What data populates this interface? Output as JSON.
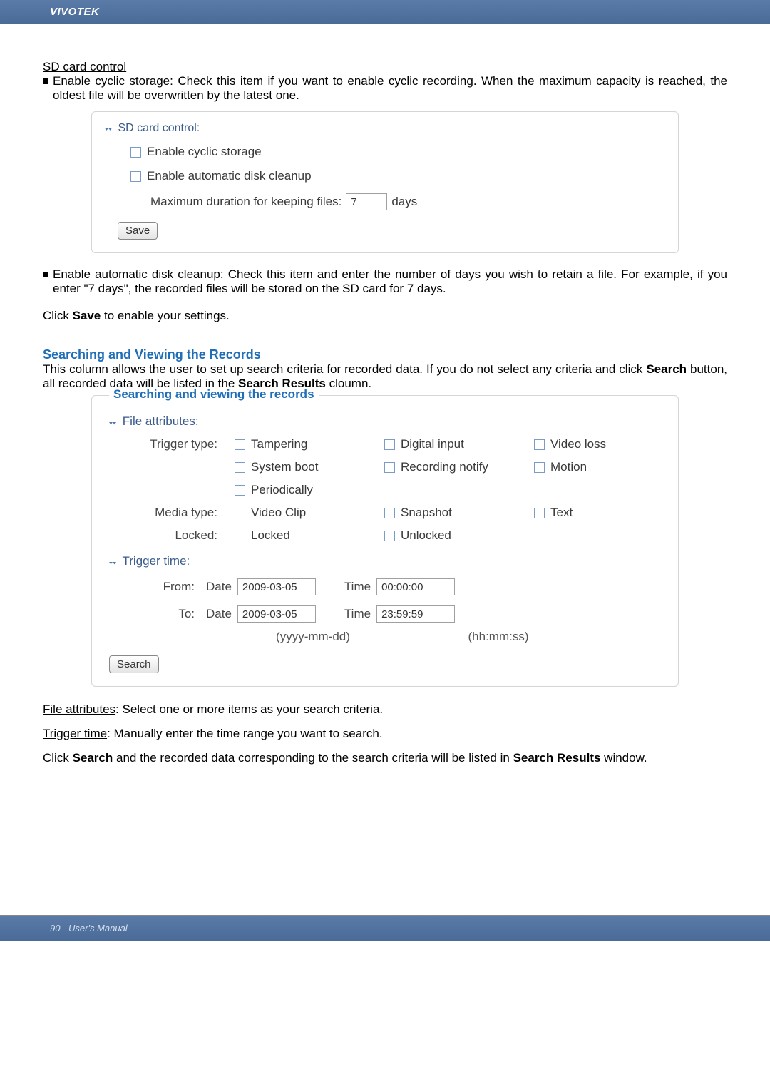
{
  "header": {
    "brand": "VIVOTEK"
  },
  "sd_card": {
    "heading": "SD card control",
    "bullet1": "Enable cyclic storage: Check this item if you want to enable cyclic recording. When the maximum capacity is reached, the oldest file will be overwritten by the latest one.",
    "panel_title": "SD card control:",
    "cb_cyclic": "Enable cyclic storage",
    "cb_cleanup": "Enable automatic disk cleanup",
    "max_dur_label": "Maximum duration for keeping files:",
    "max_dur_value": "7",
    "max_dur_unit": "days",
    "save_btn": "Save",
    "bullet2": "Enable automatic disk cleanup: Check this item and enter the number of days you wish to retain a file. For example, if you enter \"7 days\", the recorded files will be stored on the SD card for 7 days.",
    "save_note_prefix": "Click ",
    "save_note_bold": "Save",
    "save_note_suffix": " to enable your settings."
  },
  "search": {
    "heading": "Searching and Viewing the Records",
    "intro_a": "This column allows the user to set up search criteria for recorded data. If you do not select any criteria and click ",
    "intro_b": "Search",
    "intro_c": " button, all recorded data will be listed in the ",
    "intro_d": "Search Results",
    "intro_e": " cloumn.",
    "legend": "Searching and viewing the records",
    "file_attr_title": "File attributes:",
    "labels": {
      "trigger_type": "Trigger type:",
      "media_type": "Media type:",
      "locked": "Locked:",
      "trigger_time": "Trigger time:",
      "from": "From:",
      "to": "To:",
      "date": "Date",
      "time": "Time"
    },
    "opts": {
      "tampering": "Tampering",
      "digital_input": "Digital input",
      "video_loss": "Video loss",
      "system_boot": "System boot",
      "recording_notify": "Recording notify",
      "motion": "Motion",
      "periodically": "Periodically",
      "video_clip": "Video Clip",
      "snapshot": "Snapshot",
      "text": "Text",
      "locked": "Locked",
      "unlocked": "Unlocked"
    },
    "from_date": "2009-03-05",
    "from_time": "00:00:00",
    "to_date": "2009-03-05",
    "to_time": "23:59:59",
    "fmt_date": "(yyyy-mm-dd)",
    "fmt_time": "(hh:mm:ss)",
    "search_btn": "Search",
    "file_attr_desc_u": "File attributes",
    "file_attr_desc": ": Select one or more items as your search criteria.",
    "trigger_time_desc_u": "Trigger time",
    "trigger_time_desc": ": Manually enter the time range you want to search.",
    "click_a": "Click ",
    "click_b": "Search",
    "click_c": " and the recorded data corresponding to the search criteria will be listed in ",
    "click_d": "Search Results",
    "click_e": " window."
  },
  "footer": {
    "page": "90 - User's Manual"
  }
}
